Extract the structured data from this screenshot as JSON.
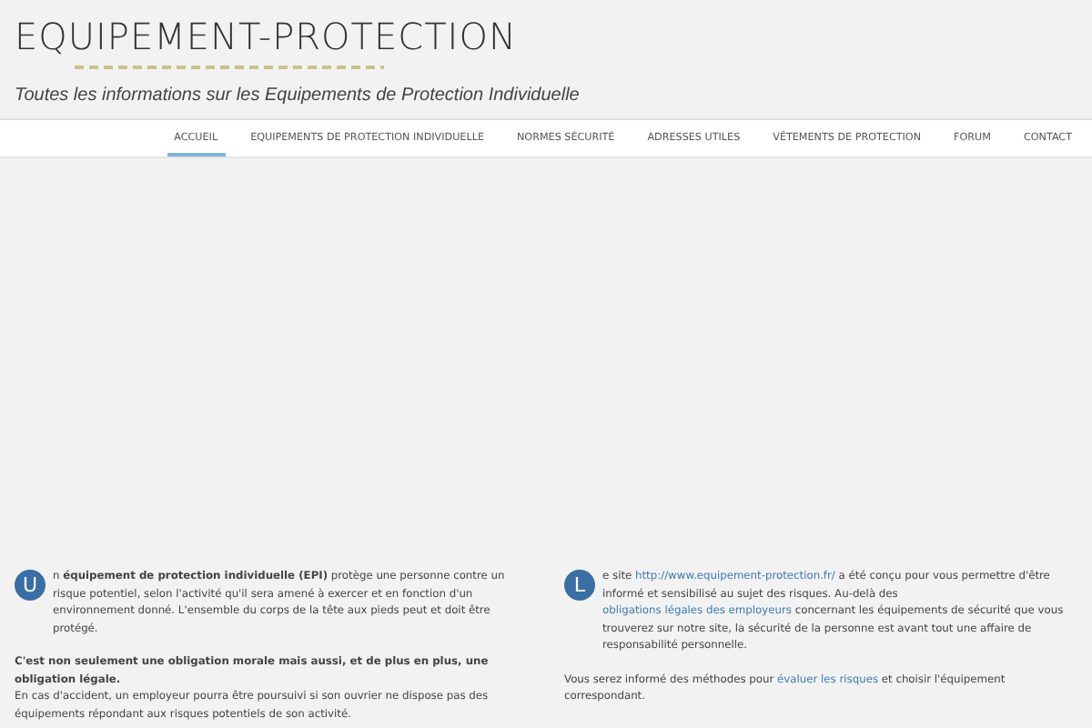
{
  "logo": {
    "title": "EQUIPEMENT-PROTECTION",
    "tagline": "Toutes les informations sur les Equipements de Protection Individuelle"
  },
  "nav": [
    {
      "label": "ACCUEIL",
      "selected": true
    },
    {
      "label": "EQUIPEMENTS DE PROTECTION INDIVIDUELLE",
      "selected": false
    },
    {
      "label": "NORMES SÉCURITÉ",
      "selected": false
    },
    {
      "label": "ADRESSES UTILES",
      "selected": false
    },
    {
      "label": "VÊTEMENTS DE PROTECTION",
      "selected": false
    },
    {
      "label": "FORUM",
      "selected": false
    },
    {
      "label": "CONTACT",
      "selected": false
    }
  ],
  "columns": [
    {
      "drop_cap": "U",
      "paragraphs": [
        [
          {
            "kind": "text",
            "text": "n "
          },
          {
            "kind": "bold",
            "text": "équipement de protection individuelle (EPI)"
          },
          {
            "kind": "text",
            "text": " protège une personne contre un risque potentiel, selon l'activité qu'il sera amené à exercer et en fonction d'un environnement donné. L'ensemble du corps de la tête aux pieds peut et doit être protégé."
          }
        ],
        [
          {
            "kind": "bold",
            "text": "C'est non seulement une obligation morale mais aussi, et de plus en plus, une obligation légale."
          },
          {
            "kind": "break"
          },
          {
            "kind": "text",
            "text": "En cas d'accident, un employeur pourra être poursuivi si son ouvrier ne dispose pas des équipements répondant aux risques potentiels de son activité."
          }
        ]
      ]
    },
    {
      "drop_cap": "L",
      "paragraphs": [
        [
          {
            "kind": "text",
            "text": "e site "
          },
          {
            "kind": "link",
            "text": "http://www.equipement-protection.fr/"
          },
          {
            "kind": "text",
            "text": "  a été conçu pour vous permettre d'être informé et sensibilisé au sujet des risques.  Au-delà des  "
          },
          {
            "kind": "link",
            "text": "obligations légales des employeurs"
          },
          {
            "kind": "text",
            "text": " concernant les équipements de sécurité que vous trouverez sur notre site, la sécurité de la personne est avant tout une affaire de responsabilité personnelle."
          }
        ],
        [
          {
            "kind": "text",
            "text": "Vous serez informé des méthodes pour "
          },
          {
            "kind": "link",
            "text": "évaluer les risques"
          },
          {
            "kind": "text",
            "text": " et choisir l'équipement correspondant."
          }
        ]
      ]
    }
  ]
}
